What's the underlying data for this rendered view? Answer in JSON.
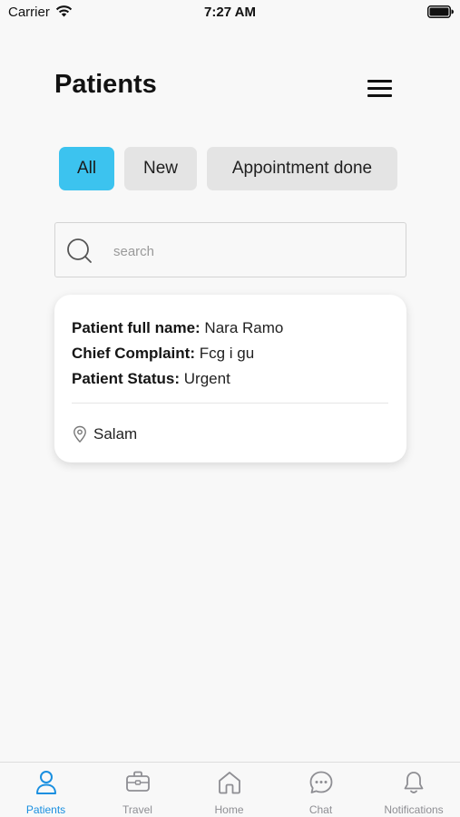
{
  "status_bar": {
    "carrier": "Carrier",
    "time": "7:27 AM"
  },
  "header": {
    "title": "Patients"
  },
  "filters": [
    {
      "label": "All",
      "active": true
    },
    {
      "label": "New",
      "active": false
    },
    {
      "label": "Appointment done",
      "active": false
    }
  ],
  "search": {
    "placeholder": "search",
    "value": ""
  },
  "patients": [
    {
      "name_label": "Patient full name:",
      "name": "Nara Ramo",
      "complaint_label": "Chief Complaint:",
      "complaint": "Fcg i gu",
      "status_label": "Patient Status:",
      "status": "Urgent",
      "location": "Salam"
    }
  ],
  "tabs": [
    {
      "label": "Patients",
      "icon": "person-icon",
      "active": true
    },
    {
      "label": "Travel",
      "icon": "briefcase-icon",
      "active": false
    },
    {
      "label": "Home",
      "icon": "home-icon",
      "active": false
    },
    {
      "label": "Chat",
      "icon": "chat-bubble-icon",
      "active": false
    },
    {
      "label": "Notifications",
      "icon": "bell-icon",
      "active": false
    }
  ],
  "colors": {
    "accent": "#3cc3ef",
    "tab_active": "#1a8fe0",
    "tab_inactive": "#8e8e93",
    "chip_bg": "#e4e4e4",
    "background": "#f8f8f8"
  }
}
